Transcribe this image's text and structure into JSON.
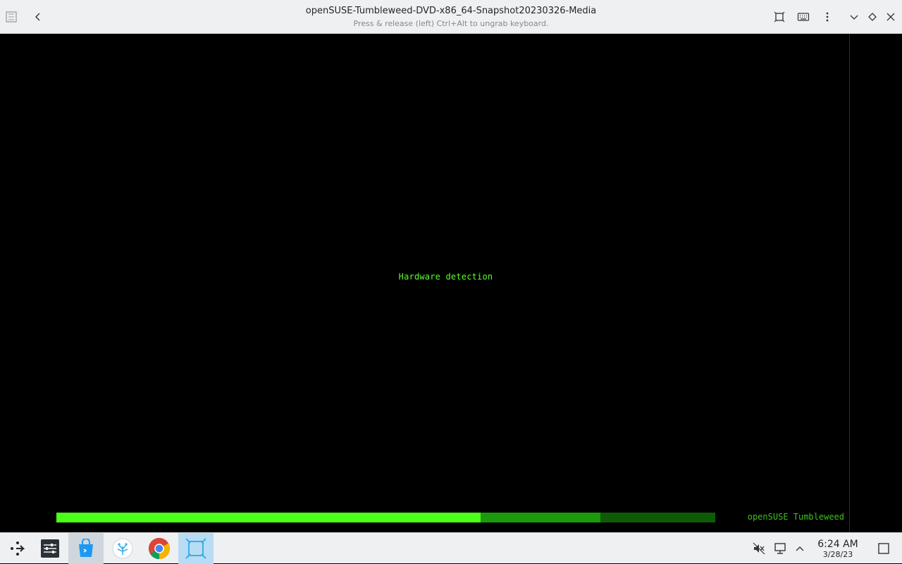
{
  "window": {
    "title": "openSUSE-Tumbleweed-DVD-x86_64-Snapshot20230326-Media",
    "subtitle": "Press & release (left) Ctrl+Alt to ungrab keyboard.",
    "icons": [
      "app-menu-icon",
      "back-icon",
      "fit-screen-icon",
      "keyboard-icon",
      "more-menu-icon",
      "minimize-icon",
      "maximize-icon",
      "close-icon"
    ]
  },
  "vm": {
    "message": "Hardware detection",
    "brand": "openSUSE Tumbleweed",
    "progress": {
      "fill_fraction": 0.644,
      "secondary_fraction": 0.826,
      "colors": {
        "fill": "#4dff19",
        "secondary": "#1b9a0b",
        "track": "#0d5c05"
      }
    }
  },
  "taskbar": {
    "apps": [
      "app-launcher",
      "system-settings",
      "discover",
      "plasma-app",
      "chrome",
      "boxes"
    ],
    "tray": [
      "mute-icon",
      "network-icon",
      "expand-tray-icon"
    ],
    "clock": {
      "time": "6:24 AM",
      "date": "3/28/23"
    }
  }
}
